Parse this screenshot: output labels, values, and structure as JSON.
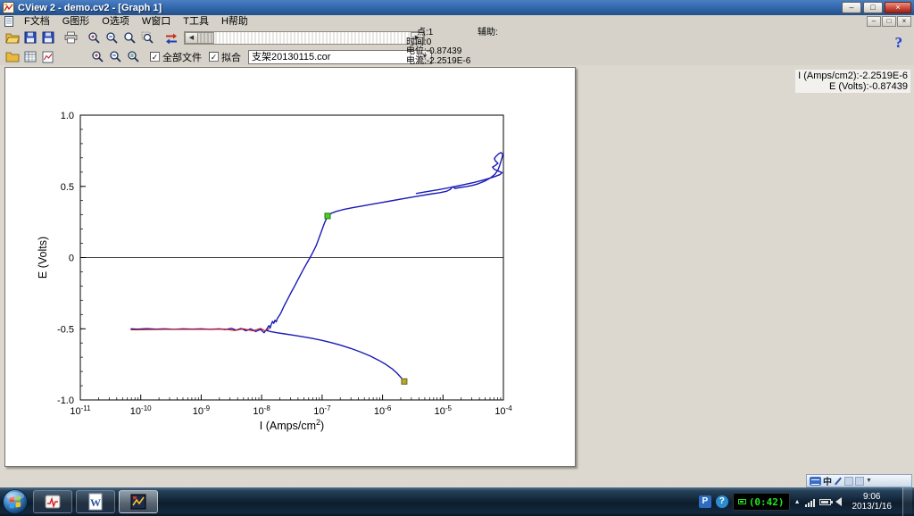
{
  "window": {
    "title": "CView 2 - demo.cv2 - [Graph 1]",
    "controls": {
      "minimize": "–",
      "maximize": "□",
      "close": "×"
    }
  },
  "icons": {
    "left": "◀",
    "right": "▶",
    "down": "▼",
    "up": "▲",
    "check": "✓",
    "chevron": "»"
  },
  "menu": {
    "items": [
      "F文档",
      "G图形",
      "O选项",
      "W窗口",
      "T工具",
      "H帮助"
    ]
  },
  "toolbar": {
    "all_files_label": "全部文件",
    "fit_label": "拟合",
    "file_combo_value": "支架20130115.cor",
    "help_glyph": "?"
  },
  "status": {
    "point": "点:1",
    "aux": "辅助:",
    "time": "时间:0",
    "potential": "电位:-0.87439",
    "current": "电流:-2.2519E-6"
  },
  "readout": {
    "current_line": "I (Amps/cm2):-2.2519E-6",
    "voltage_line": "E (Volts):-0.87439"
  },
  "chart_data": {
    "type": "line",
    "title": "",
    "xlabel": {
      "pre": "I (Amps/cm",
      "sup": "2",
      "post": ")"
    },
    "ylabel": "E (Volts)",
    "x_scale": "log",
    "xlim_exp": [
      -11,
      -4
    ],
    "ylim": [
      -1.0,
      1.0
    ],
    "y_ticks": [
      {
        "v": -1.0,
        "label": "-1.0"
      },
      {
        "v": -0.5,
        "label": "-0.5"
      },
      {
        "v": 0,
        "label": "0"
      },
      {
        "v": 0.5,
        "label": "0.5"
      },
      {
        "v": 1.0,
        "label": "1.0"
      }
    ],
    "zero_line": true,
    "series": [
      {
        "name": "polarization-forward-and-reverse",
        "color": "#1a1ab8",
        "width": 1.4,
        "points": [
          [
            -10.16,
            -0.5
          ],
          [
            -10.05,
            -0.503
          ],
          [
            -9.9,
            -0.499
          ],
          [
            -9.75,
            -0.503
          ],
          [
            -9.6,
            -0.5
          ],
          [
            -9.45,
            -0.504
          ],
          [
            -9.3,
            -0.5
          ],
          [
            -9.15,
            -0.503
          ],
          [
            -9.0,
            -0.5
          ],
          [
            -8.85,
            -0.504
          ],
          [
            -8.7,
            -0.5
          ],
          [
            -8.6,
            -0.506
          ],
          [
            -8.5,
            -0.497
          ],
          [
            -8.42,
            -0.51
          ],
          [
            -8.34,
            -0.498
          ],
          [
            -8.26,
            -0.514
          ],
          [
            -8.18,
            -0.5
          ],
          [
            -8.1,
            -0.52
          ],
          [
            -8.02,
            -0.505
          ],
          [
            -7.96,
            -0.528
          ],
          [
            -7.92,
            -0.505
          ],
          [
            -7.88,
            -0.478
          ],
          [
            -7.86,
            -0.495
          ],
          [
            -7.84,
            -0.468
          ],
          [
            -7.82,
            -0.448
          ],
          [
            -7.8,
            -0.462
          ],
          [
            -7.78,
            -0.44
          ],
          [
            -7.76,
            -0.452
          ],
          [
            -7.74,
            -0.428
          ],
          [
            -7.71,
            -0.408
          ],
          [
            -7.68,
            -0.388
          ],
          [
            -7.65,
            -0.36
          ],
          [
            -7.62,
            -0.332
          ],
          [
            -7.58,
            -0.3
          ],
          [
            -7.54,
            -0.268
          ],
          [
            -7.5,
            -0.235
          ],
          [
            -7.46,
            -0.205
          ],
          [
            -7.42,
            -0.172
          ],
          [
            -7.38,
            -0.14
          ],
          [
            -7.34,
            -0.108
          ],
          [
            -7.3,
            -0.076
          ],
          [
            -7.26,
            -0.045
          ],
          [
            -7.22,
            -0.015
          ],
          [
            -7.18,
            0.015
          ],
          [
            -7.14,
            0.048
          ],
          [
            -7.1,
            0.082
          ],
          [
            -7.07,
            0.115
          ],
          [
            -7.04,
            0.15
          ],
          [
            -7.01,
            0.185
          ],
          [
            -6.98,
            0.22
          ],
          [
            -6.95,
            0.252
          ],
          [
            -6.92,
            0.28
          ],
          [
            -6.89,
            0.298
          ],
          [
            -6.84,
            0.312
          ],
          [
            -6.76,
            0.325
          ],
          [
            -6.64,
            0.338
          ],
          [
            -6.5,
            0.35
          ],
          [
            -6.34,
            0.362
          ],
          [
            -6.18,
            0.374
          ],
          [
            -6.02,
            0.386
          ],
          [
            -5.86,
            0.398
          ],
          [
            -5.7,
            0.41
          ],
          [
            -5.54,
            0.422
          ],
          [
            -5.38,
            0.434
          ],
          [
            -5.22,
            0.445
          ],
          [
            -5.06,
            0.455
          ],
          [
            -4.94,
            0.465
          ],
          [
            -4.88,
            0.478
          ],
          [
            -4.84,
            0.498
          ],
          [
            -4.8,
            0.486
          ],
          [
            -4.72,
            0.492
          ],
          [
            -4.62,
            0.498
          ],
          [
            -4.52,
            0.506
          ],
          [
            -4.42,
            0.518
          ],
          [
            -4.32,
            0.535
          ],
          [
            -4.22,
            0.558
          ],
          [
            -4.14,
            0.585
          ],
          [
            -4.09,
            0.615
          ],
          [
            -4.06,
            0.648
          ],
          [
            -4.04,
            0.678
          ],
          [
            -4.02,
            0.705
          ],
          [
            -4.01,
            0.725
          ],
          [
            -4.04,
            0.738
          ],
          [
            -4.08,
            0.728
          ],
          [
            -4.12,
            0.712
          ],
          [
            -4.15,
            0.695
          ],
          [
            -4.13,
            0.678
          ],
          [
            -4.09,
            0.662
          ],
          [
            -4.13,
            0.648
          ],
          [
            -4.18,
            0.635
          ],
          [
            -4.15,
            0.62
          ],
          [
            -4.08,
            0.606
          ],
          [
            -4.02,
            0.596
          ],
          [
            -4.06,
            0.582
          ],
          [
            -4.16,
            0.566
          ],
          [
            -4.3,
            0.548
          ],
          [
            -4.48,
            0.528
          ],
          [
            -4.68,
            0.51
          ],
          [
            -4.88,
            0.492
          ],
          [
            -5.08,
            0.476
          ],
          [
            -5.28,
            0.462
          ],
          [
            -5.44,
            0.45
          ]
        ]
      },
      {
        "name": "polarization-cathodic",
        "color": "#1a1ab8",
        "width": 1.4,
        "points": [
          [
            -7.92,
            -0.512
          ],
          [
            -7.85,
            -0.52
          ],
          [
            -7.75,
            -0.528
          ],
          [
            -7.62,
            -0.536
          ],
          [
            -7.48,
            -0.545
          ],
          [
            -7.32,
            -0.556
          ],
          [
            -7.16,
            -0.568
          ],
          [
            -7.0,
            -0.582
          ],
          [
            -6.84,
            -0.598
          ],
          [
            -6.68,
            -0.617
          ],
          [
            -6.52,
            -0.639
          ],
          [
            -6.36,
            -0.664
          ],
          [
            -6.2,
            -0.692
          ],
          [
            -6.06,
            -0.722
          ],
          [
            -5.94,
            -0.752
          ],
          [
            -5.84,
            -0.782
          ],
          [
            -5.76,
            -0.812
          ],
          [
            -5.7,
            -0.84
          ],
          [
            -5.66,
            -0.862
          ],
          [
            -5.64,
            -0.87
          ]
        ]
      },
      {
        "name": "fit-line",
        "color": "#cc1111",
        "width": 1.1,
        "points": [
          [
            -10.16,
            -0.507
          ],
          [
            -9.6,
            -0.505
          ],
          [
            -9.0,
            -0.504
          ],
          [
            -8.6,
            -0.503
          ],
          [
            -8.45,
            -0.512
          ],
          [
            -8.3,
            -0.5
          ],
          [
            -8.15,
            -0.515
          ],
          [
            -8.02,
            -0.498
          ],
          [
            -7.94,
            -0.515
          ],
          [
            -7.88,
            -0.5
          ]
        ]
      }
    ],
    "markers": [
      {
        "name": "start-marker",
        "x_exp": -6.91,
        "y": 0.292,
        "color": "#4ecb2a",
        "border": "#1f7a0e"
      },
      {
        "name": "end-marker",
        "x_exp": -5.64,
        "y": -0.87,
        "color": "#b3a92f",
        "border": "#6b6414"
      }
    ]
  },
  "langbar": {
    "lang": "中"
  },
  "taskbar": {
    "tray_p": "P",
    "tray_help": "?",
    "recorder": "(0:42)",
    "clock_time": "9:06",
    "clock_date": "2013/1/16"
  }
}
